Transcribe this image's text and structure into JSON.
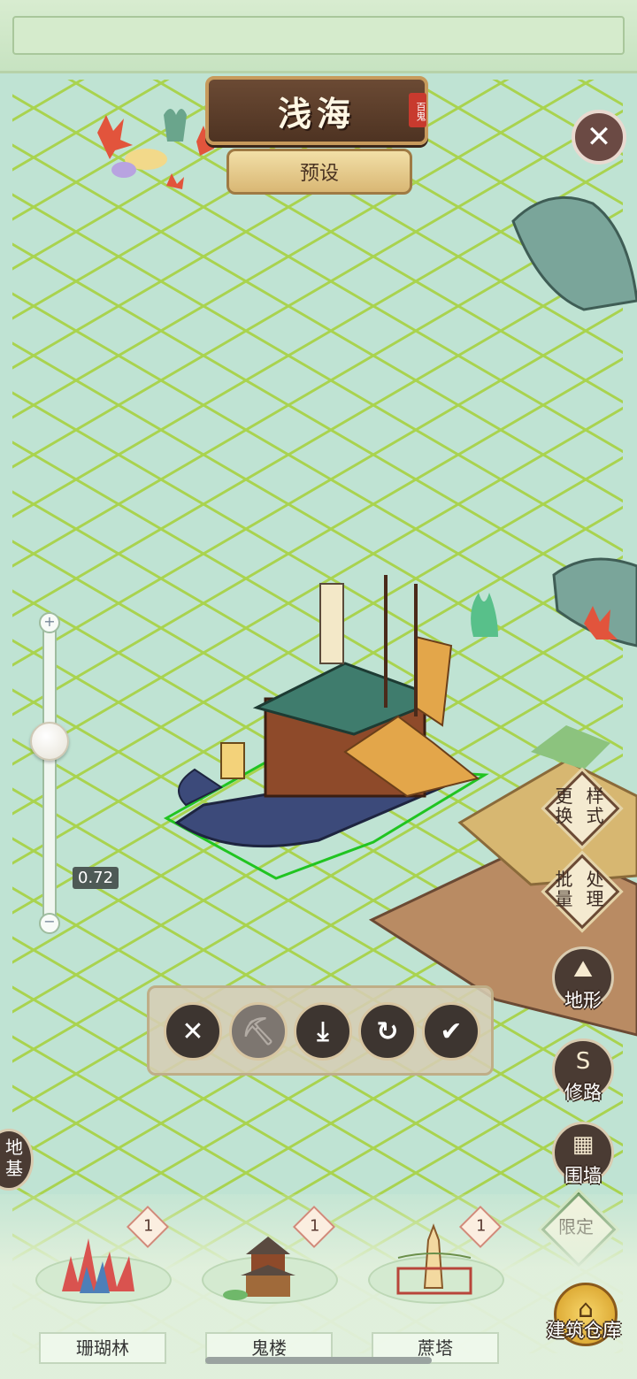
{
  "header": {
    "title": "浅海",
    "seal_text": "百鬼",
    "preset_label": "预设",
    "close_icon": "close-icon"
  },
  "zoom": {
    "value_label": "0.72",
    "level": 0.72,
    "plus_label": "+",
    "minus_label": "−"
  },
  "action_bar": {
    "buttons": [
      {
        "name": "cancel",
        "icon": "close-icon",
        "glyph": "✕"
      },
      {
        "name": "demolish",
        "icon": "axe-icon",
        "glyph": "⛏",
        "disabled": true
      },
      {
        "name": "store",
        "icon": "download-icon",
        "glyph": "⤓"
      },
      {
        "name": "rotate",
        "icon": "rotate-icon",
        "glyph": "↻"
      },
      {
        "name": "confirm",
        "icon": "check-icon",
        "glyph": "✔"
      }
    ]
  },
  "side_menu": {
    "change_style": "更换样式",
    "change_style_lines": [
      "更换",
      "样式"
    ],
    "batch": "批量处理",
    "batch_lines": [
      "批量",
      "处理"
    ],
    "terrain": "地形",
    "road": "修路",
    "wall": "围墙",
    "limited": "限定",
    "warehouse": "建筑仓库",
    "foundation": "地基"
  },
  "buildings": [
    {
      "name": "珊瑚林",
      "count": "1"
    },
    {
      "name": "鬼楼",
      "count": "1"
    },
    {
      "name": "蔗塔",
      "count": "1"
    }
  ],
  "colors": {
    "water": "#bfe3d3",
    "grid": "#9fd04a",
    "selection": "#21c421",
    "panel": "#4a3b33"
  }
}
